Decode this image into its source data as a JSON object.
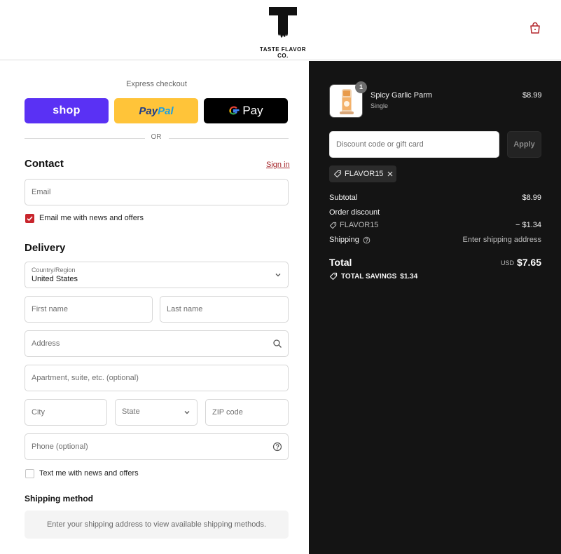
{
  "header": {
    "logo_letter": "T",
    "logo_text": "TASTE FLAVOR CO.",
    "bag_icon": "shopping-bag-icon"
  },
  "express": {
    "title": "Express checkout",
    "shop_label": "shop",
    "paypal_label_1": "Pay",
    "paypal_label_2": "Pal",
    "gpay_label": "Pay",
    "or_text": "OR"
  },
  "contact": {
    "title": "Contact",
    "sign_in": "Sign in",
    "email_placeholder": "Email",
    "newsletter_label": "Email me with news and offers",
    "newsletter_checked": true
  },
  "delivery": {
    "title": "Delivery",
    "country_label": "Country/Region",
    "country_value": "United States",
    "first_name_placeholder": "First name",
    "last_name_placeholder": "Last name",
    "address_placeholder": "Address",
    "apartment_placeholder": "Apartment, suite, etc. (optional)",
    "city_placeholder": "City",
    "state_placeholder": "State",
    "zip_placeholder": "ZIP code",
    "phone_placeholder": "Phone (optional)",
    "sms_label": "Text me with news and offers",
    "sms_checked": false
  },
  "shipping": {
    "title": "Shipping method",
    "message": "Enter your shipping address to view available shipping methods."
  },
  "summary": {
    "product": {
      "name": "Spicy Garlic Parm",
      "variant": "Single",
      "price": "$8.99",
      "quantity": "1"
    },
    "discount_placeholder": "Discount code or gift card",
    "apply_label": "Apply",
    "applied_code": "FLAVOR15",
    "subtotal_label": "Subtotal",
    "subtotal_value": "$8.99",
    "order_discount_label": "Order discount",
    "discount_code": "FLAVOR15",
    "discount_value": "− $1.34",
    "shipping_label": "Shipping",
    "shipping_value": "Enter shipping address",
    "total_label": "Total",
    "total_currency": "USD",
    "total_value": "$7.65",
    "savings_label": "TOTAL SAVINGS",
    "savings_value": "$1.34"
  },
  "colors": {
    "brand_red": "#c8252c",
    "shop_purple": "#5a31f4",
    "paypal_yellow": "#ffc439",
    "summary_bg": "#141414"
  }
}
